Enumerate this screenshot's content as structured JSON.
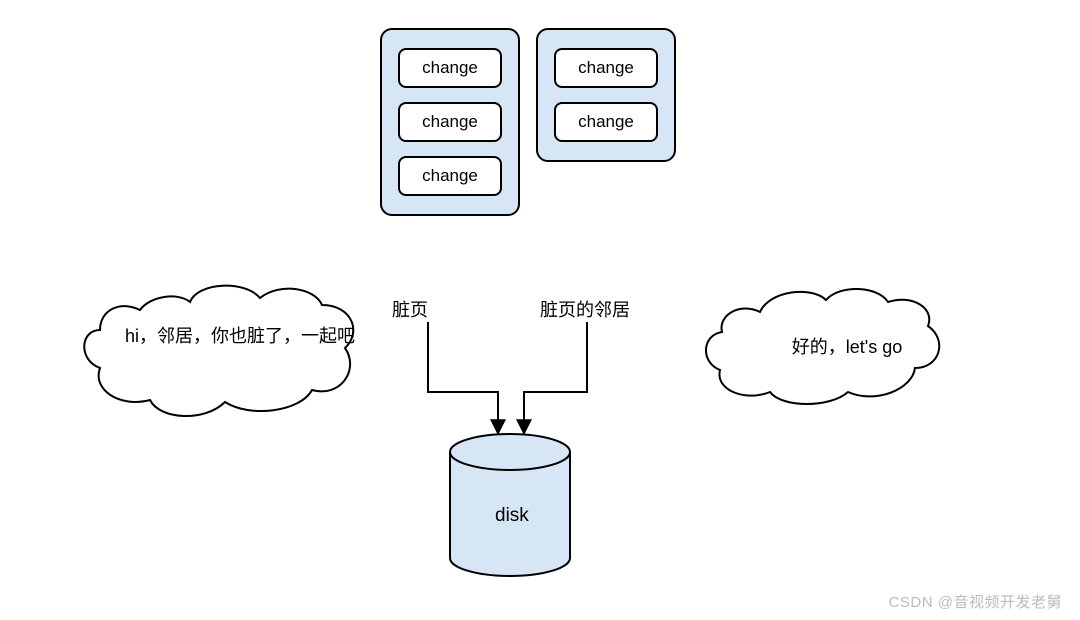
{
  "pages": {
    "left": {
      "label": "脏页",
      "items": [
        "change",
        "change",
        "change"
      ]
    },
    "right": {
      "label": "脏页的邻居",
      "items": [
        "change",
        "change"
      ]
    }
  },
  "speech": {
    "left": "hi，邻居，你也脏了，一起吧",
    "right": "好的，let's go"
  },
  "disk": {
    "label": "disk"
  },
  "watermark": "CSDN @音视频开发老舅"
}
